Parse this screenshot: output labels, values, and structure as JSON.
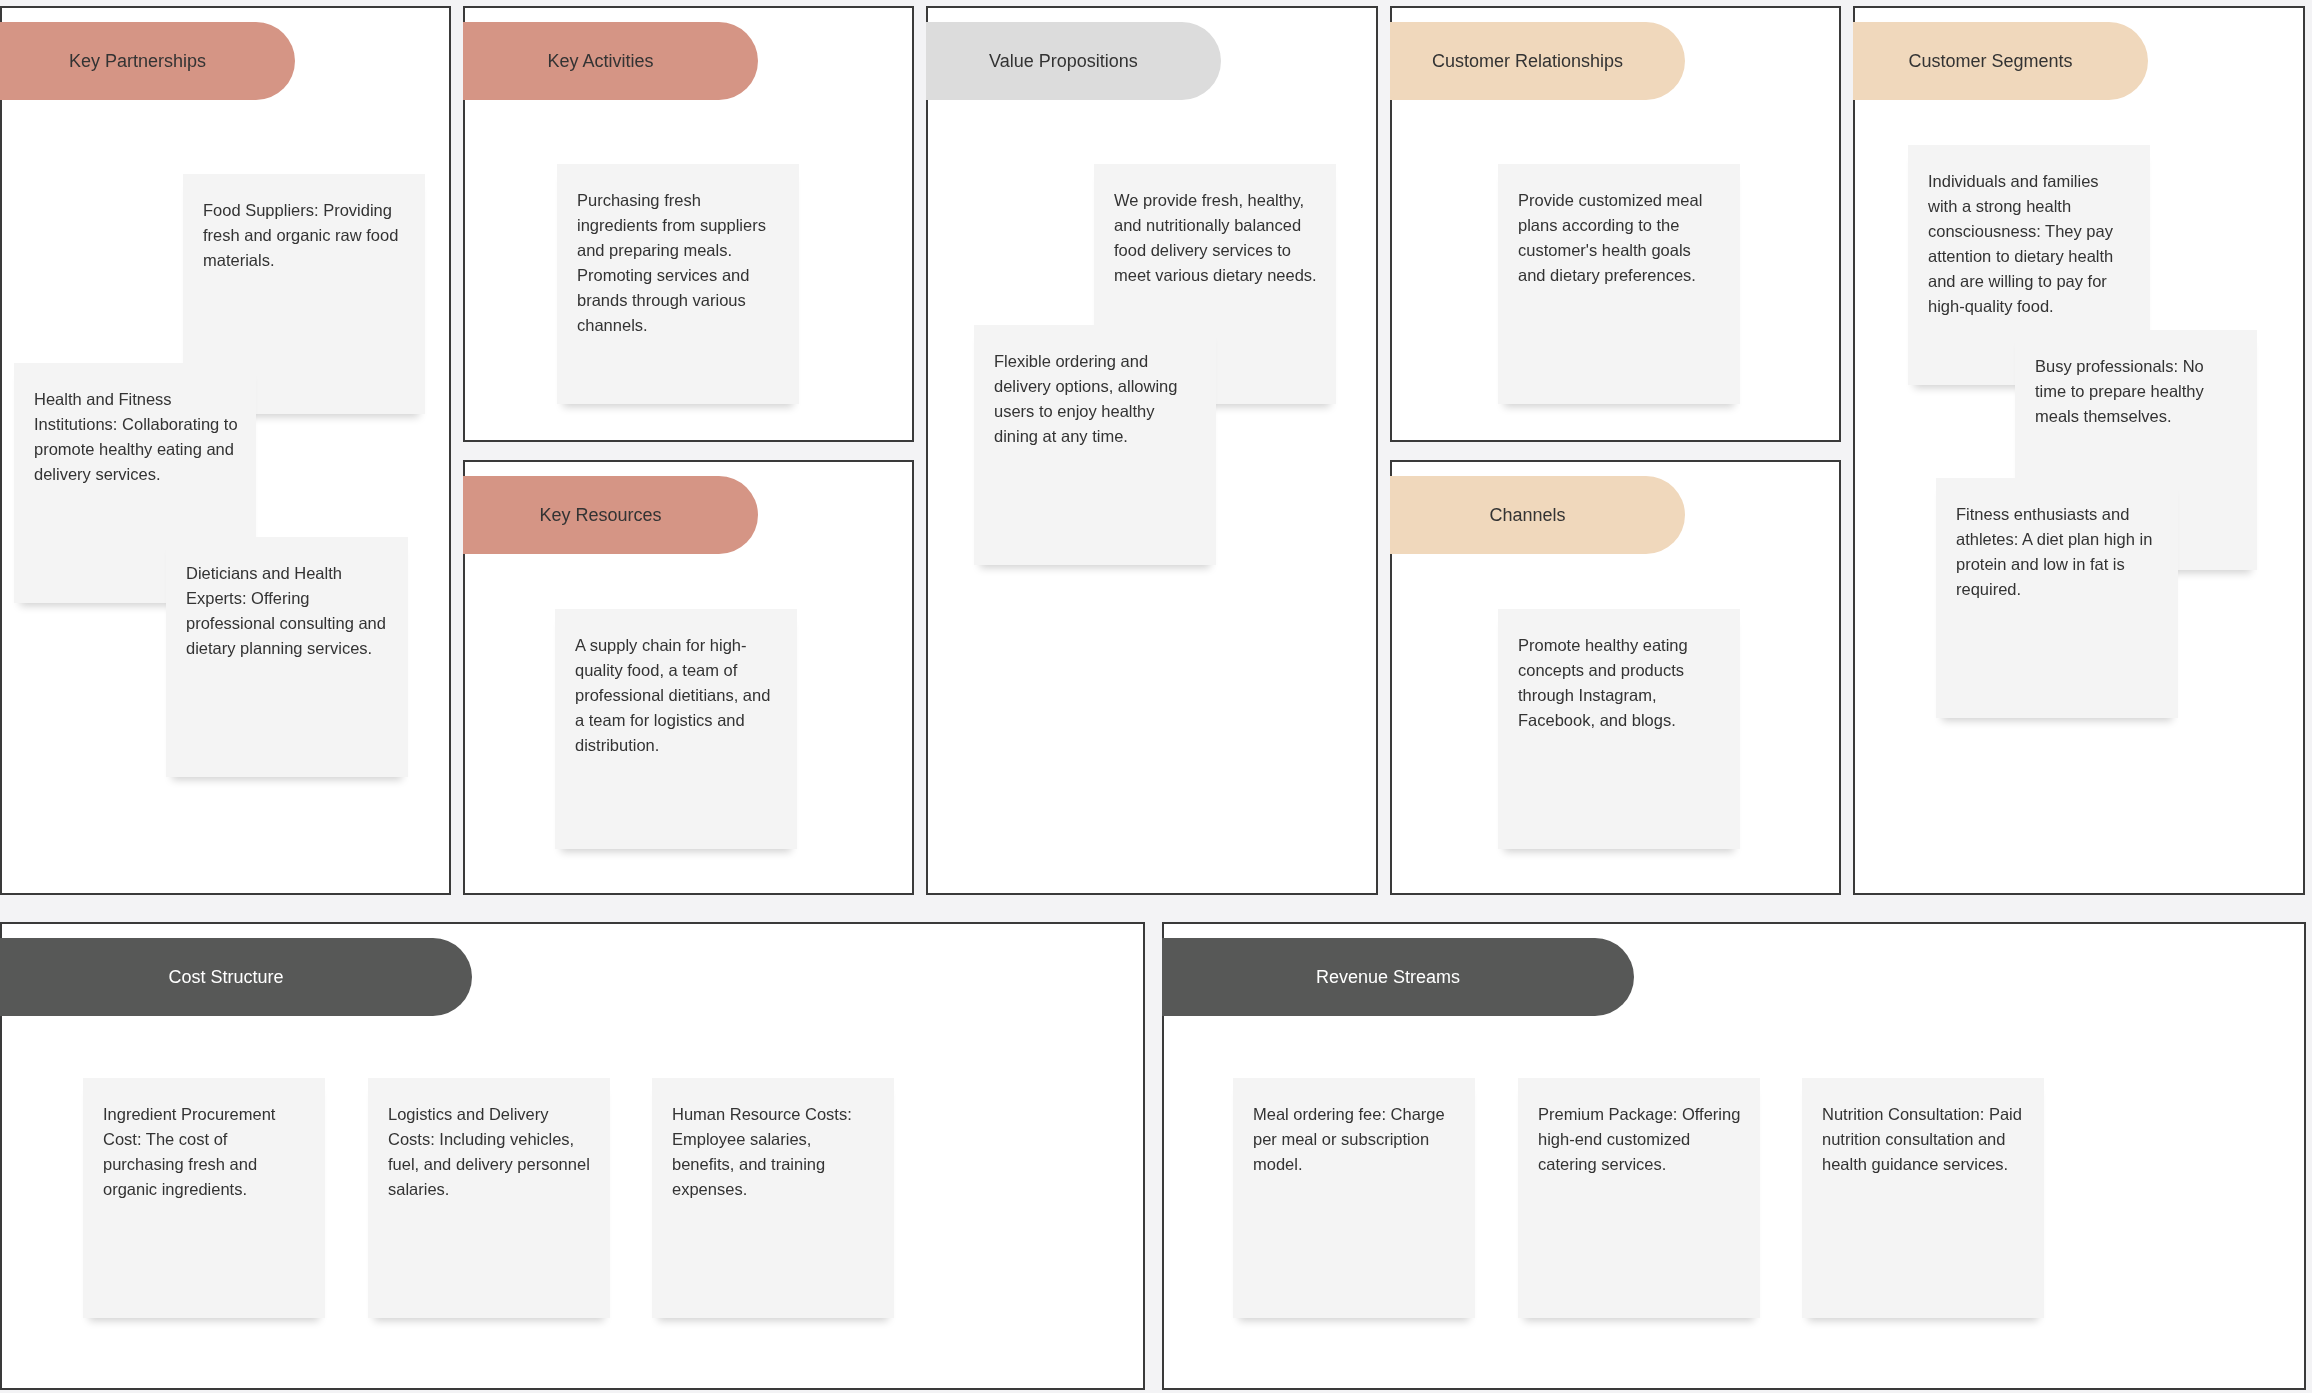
{
  "blocks": [
    {
      "title": "Key Partnerships",
      "color": "#d59585",
      "notes": [
        "Food Suppliers: Providing fresh and organic raw food materials.",
        "Health and Fitness Institutions: Collaborating to promote healthy eating and delivery services.",
        "Dieticians and Health Experts: Offering professional consulting and dietary planning services."
      ]
    },
    {
      "title": "Key Activities",
      "color": "#d59585",
      "notes": [
        "Purchasing fresh ingredients from suppliers and preparing meals. Promoting services and brands through various channels."
      ]
    },
    {
      "title": "Key Resources",
      "color": "#d59585",
      "notes": [
        "A supply chain for high-quality food, a team of professional dietitians, and a team for logistics and distribution."
      ]
    },
    {
      "title": "Value Propositions",
      "color": "#dcdcdc",
      "notes": [
        "We provide fresh, healthy, and nutritionally balanced food delivery services to meet various dietary needs.",
        "Flexible ordering and delivery options, allowing users to enjoy healthy dining at any time."
      ]
    },
    {
      "title": "Customer Relationships",
      "color": "#f0d8bc",
      "notes": [
        "Provide customized meal plans according to the customer's health goals and dietary preferences."
      ]
    },
    {
      "title": "Channels",
      "color": "#f0d8bc",
      "notes": [
        "Promote healthy eating concepts and products through Instagram, Facebook, and blogs."
      ]
    },
    {
      "title": "Customer Segments",
      "color": "#f0d8bc",
      "notes": [
        "Individuals and families with a strong health consciousness: They pay attention to dietary health and are willing to pay for high-quality food.",
        "Busy professionals: No time to prepare healthy meals themselves.",
        "Fitness enthusiasts and athletes: A diet plan high in protein and low in fat is required."
      ]
    },
    {
      "title": "Cost Structure",
      "color": "#575857",
      "notes": [
        "Ingredient Procurement Cost: The cost of purchasing fresh and organic ingredients.",
        "Logistics and Delivery Costs: Including vehicles, fuel, and delivery personnel salaries.",
        "Human Resource Costs: Employee salaries, benefits, and training expenses."
      ]
    },
    {
      "title": "Revenue Streams",
      "color": "#575857",
      "notes": [
        "Meal ordering fee: Charge per meal or subscription model.",
        "Premium Package: Offering high-end customized catering services.",
        "Nutrition Consultation: Paid nutrition consultation and health guidance services."
      ]
    }
  ]
}
